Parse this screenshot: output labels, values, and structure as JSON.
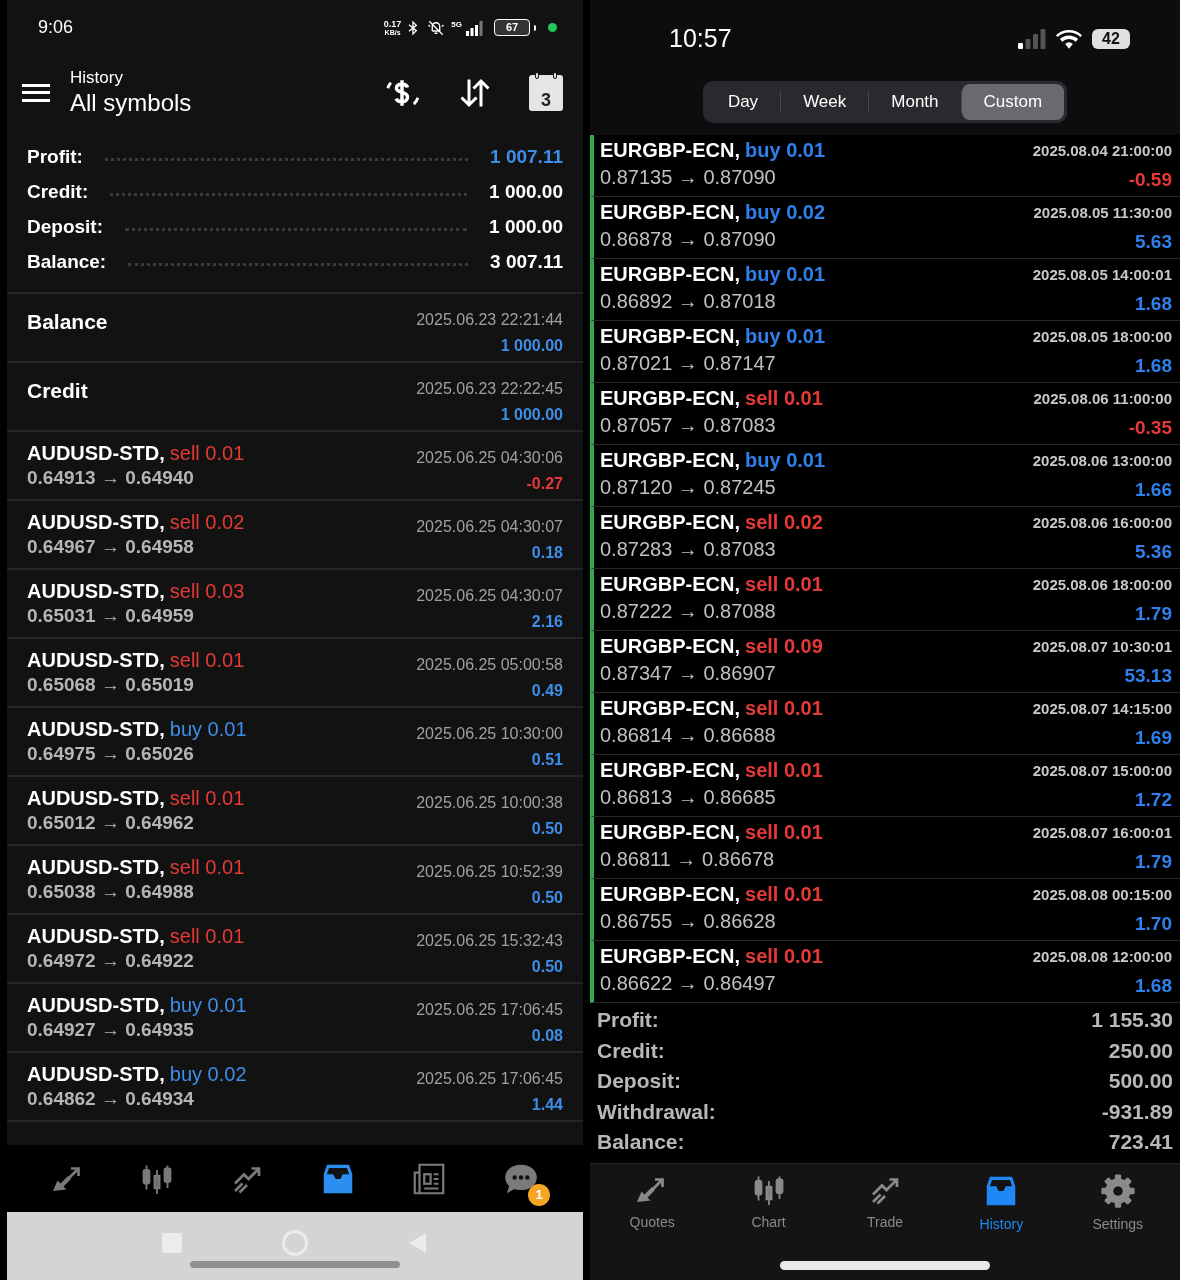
{
  "left_phone": {
    "status_bar": {
      "time": "9:06",
      "net_speed": "0.17",
      "net_unit": "KB/s",
      "network": "5G",
      "battery": "67"
    },
    "header": {
      "subtitle": "History",
      "title": "All symbols",
      "calendar_day": "3"
    },
    "summary": [
      {
        "label": "Profit:",
        "value": "1 007.11",
        "highlight": true
      },
      {
        "label": "Credit:",
        "value": "1 000.00",
        "highlight": false
      },
      {
        "label": "Deposit:",
        "value": "1 000.00",
        "highlight": false
      },
      {
        "label": "Balance:",
        "value": "3 007.11",
        "highlight": false
      }
    ],
    "entries": [
      {
        "kind": "operation",
        "label": "Balance",
        "time": "2025.06.23 22:21:44",
        "amount": "1 000.00"
      },
      {
        "kind": "operation",
        "label": "Credit",
        "time": "2025.06.23 22:22:45",
        "amount": "1 000.00"
      },
      {
        "kind": "trade",
        "symbol": "AUDUSD-STD,",
        "side": {
          "text": "sell 0.01",
          "color": "#e53935"
        },
        "prices": "0.64913 → 0.64940",
        "time": "2025.06.25 04:30:06",
        "profit": {
          "text": "-0.27",
          "color": "#e53935"
        }
      },
      {
        "kind": "trade",
        "symbol": "AUDUSD-STD,",
        "side": {
          "text": "sell 0.02",
          "color": "#e53935"
        },
        "prices": "0.64967 → 0.64958",
        "time": "2025.06.25 04:30:07",
        "profit": {
          "text": "0.18",
          "color": "#3d8ee8"
        }
      },
      {
        "kind": "trade",
        "symbol": "AUDUSD-STD,",
        "side": {
          "text": "sell 0.03",
          "color": "#e53935"
        },
        "prices": "0.65031 → 0.64959",
        "time": "2025.06.25 04:30:07",
        "profit": {
          "text": "2.16",
          "color": "#3d8ee8"
        }
      },
      {
        "kind": "trade",
        "symbol": "AUDUSD-STD,",
        "side": {
          "text": "sell 0.01",
          "color": "#e53935"
        },
        "prices": "0.65068 → 0.65019",
        "time": "2025.06.25 05:00:58",
        "profit": {
          "text": "0.49",
          "color": "#3d8ee8"
        }
      },
      {
        "kind": "trade",
        "symbol": "AUDUSD-STD,",
        "side": {
          "text": "buy 0.01",
          "color": "#3d8ee8"
        },
        "prices": "0.64975 → 0.65026",
        "time": "2025.06.25 10:30:00",
        "profit": {
          "text": "0.51",
          "color": "#3d8ee8"
        }
      },
      {
        "kind": "trade",
        "symbol": "AUDUSD-STD,",
        "side": {
          "text": "sell 0.01",
          "color": "#e53935"
        },
        "prices": "0.65012 → 0.64962",
        "time": "2025.06.25 10:00:38",
        "profit": {
          "text": "0.50",
          "color": "#3d8ee8"
        }
      },
      {
        "kind": "trade",
        "symbol": "AUDUSD-STD,",
        "side": {
          "text": "sell 0.01",
          "color": "#e53935"
        },
        "prices": "0.65038 → 0.64988",
        "time": "2025.06.25 10:52:39",
        "profit": {
          "text": "0.50",
          "color": "#3d8ee8"
        }
      },
      {
        "kind": "trade",
        "symbol": "AUDUSD-STD,",
        "side": {
          "text": "sell 0.01",
          "color": "#e53935"
        },
        "prices": "0.64972 → 0.64922",
        "time": "2025.06.25 15:32:43",
        "profit": {
          "text": "0.50",
          "color": "#3d8ee8"
        }
      },
      {
        "kind": "trade",
        "symbol": "AUDUSD-STD,",
        "side": {
          "text": "buy 0.01",
          "color": "#3d8ee8"
        },
        "prices": "0.64927 → 0.64935",
        "time": "2025.06.25 17:06:45",
        "profit": {
          "text": "0.08",
          "color": "#3d8ee8"
        }
      },
      {
        "kind": "trade",
        "symbol": "AUDUSD-STD,",
        "side": {
          "text": "buy 0.02",
          "color": "#3d8ee8"
        },
        "prices": "0.64862 → 0.64934",
        "time": "2025.06.25 17:06:45",
        "profit": {
          "text": "1.44",
          "color": "#3d8ee8"
        }
      }
    ],
    "nav": [
      {
        "selected": false
      },
      {
        "selected": false
      },
      {
        "selected": false
      },
      {
        "selected": true
      },
      {
        "selected": false
      },
      {
        "selected": false,
        "badge": "1"
      }
    ]
  },
  "right_phone": {
    "status_bar": {
      "time": "10:57",
      "battery": "42"
    },
    "periods": [
      {
        "label": "Day",
        "selected": false
      },
      {
        "label": "Week",
        "selected": false
      },
      {
        "label": "Month",
        "selected": false
      },
      {
        "label": "Custom",
        "selected": true
      }
    ],
    "trades": [
      {
        "symbol": "EURGBP-ECN,",
        "side": {
          "text": "buy 0.01",
          "color": "#2f80ed"
        },
        "prices": "0.87135 → 0.87090",
        "time": "2025.08.04 21:00:00",
        "profit": {
          "text": "-0.59",
          "color": "#e53935"
        }
      },
      {
        "symbol": "EURGBP-ECN,",
        "side": {
          "text": "buy 0.02",
          "color": "#2f80ed"
        },
        "prices": "0.86878 → 0.87090",
        "time": "2025.08.05 11:30:00",
        "profit": {
          "text": "5.63",
          "color": "#2f80ed"
        }
      },
      {
        "symbol": "EURGBP-ECN,",
        "side": {
          "text": "buy 0.01",
          "color": "#2f80ed"
        },
        "prices": "0.86892 → 0.87018",
        "time": "2025.08.05 14:00:01",
        "profit": {
          "text": "1.68",
          "color": "#2f80ed"
        }
      },
      {
        "symbol": "EURGBP-ECN,",
        "side": {
          "text": "buy 0.01",
          "color": "#2f80ed"
        },
        "prices": "0.87021 → 0.87147",
        "time": "2025.08.05 18:00:00",
        "profit": {
          "text": "1.68",
          "color": "#2f80ed"
        }
      },
      {
        "symbol": "EURGBP-ECN,",
        "side": {
          "text": "sell 0.01",
          "color": "#e53935"
        },
        "prices": "0.87057 → 0.87083",
        "time": "2025.08.06 11:00:00",
        "profit": {
          "text": "-0.35",
          "color": "#e53935"
        }
      },
      {
        "symbol": "EURGBP-ECN,",
        "side": {
          "text": "buy 0.01",
          "color": "#2f80ed"
        },
        "prices": "0.87120 → 0.87245",
        "time": "2025.08.06 13:00:00",
        "profit": {
          "text": "1.66",
          "color": "#2f80ed"
        }
      },
      {
        "symbol": "EURGBP-ECN,",
        "side": {
          "text": "sell 0.02",
          "color": "#e53935"
        },
        "prices": "0.87283 → 0.87083",
        "time": "2025.08.06 16:00:00",
        "profit": {
          "text": "5.36",
          "color": "#2f80ed"
        }
      },
      {
        "symbol": "EURGBP-ECN,",
        "side": {
          "text": "sell 0.01",
          "color": "#e53935"
        },
        "prices": "0.87222 → 0.87088",
        "time": "2025.08.06 18:00:00",
        "profit": {
          "text": "1.79",
          "color": "#2f80ed"
        }
      },
      {
        "symbol": "EURGBP-ECN,",
        "side": {
          "text": "sell 0.09",
          "color": "#e53935"
        },
        "prices": "0.87347 → 0.86907",
        "time": "2025.08.07 10:30:01",
        "profit": {
          "text": "53.13",
          "color": "#2f80ed"
        }
      },
      {
        "symbol": "EURGBP-ECN,",
        "side": {
          "text": "sell 0.01",
          "color": "#e53935"
        },
        "prices": "0.86814 → 0.86688",
        "time": "2025.08.07 14:15:00",
        "profit": {
          "text": "1.69",
          "color": "#2f80ed"
        }
      },
      {
        "symbol": "EURGBP-ECN,",
        "side": {
          "text": "sell 0.01",
          "color": "#e53935"
        },
        "prices": "0.86813 → 0.86685",
        "time": "2025.08.07 15:00:00",
        "profit": {
          "text": "1.72",
          "color": "#2f80ed"
        }
      },
      {
        "symbol": "EURGBP-ECN,",
        "side": {
          "text": "sell 0.01",
          "color": "#e53935"
        },
        "prices": "0.86811 → 0.86678",
        "time": "2025.08.07 16:00:01",
        "profit": {
          "text": "1.79",
          "color": "#2f80ed"
        }
      },
      {
        "symbol": "EURGBP-ECN,",
        "side": {
          "text": "sell 0.01",
          "color": "#e53935"
        },
        "prices": "0.86755 → 0.86628",
        "time": "2025.08.08 00:15:00",
        "profit": {
          "text": "1.70",
          "color": "#2f80ed"
        }
      },
      {
        "symbol": "EURGBP-ECN,",
        "side": {
          "text": "sell 0.01",
          "color": "#e53935"
        },
        "prices": "0.86622 → 0.86497",
        "time": "2025.08.08 12:00:00",
        "profit": {
          "text": "1.68",
          "color": "#2f80ed"
        }
      }
    ],
    "summary": [
      {
        "label": "Profit:",
        "value": "1 155.30"
      },
      {
        "label": "Credit:",
        "value": "250.00"
      },
      {
        "label": "Deposit:",
        "value": "500.00"
      },
      {
        "label": "Withdrawal:",
        "value": "-931.89"
      },
      {
        "label": "Balance:",
        "value": "723.41"
      }
    ],
    "tabs": [
      {
        "label": "Quotes",
        "selected": false
      },
      {
        "label": "Chart",
        "selected": false
      },
      {
        "label": "Trade",
        "selected": false
      },
      {
        "label": "History",
        "selected": true
      },
      {
        "label": "Settings",
        "selected": false
      }
    ]
  }
}
